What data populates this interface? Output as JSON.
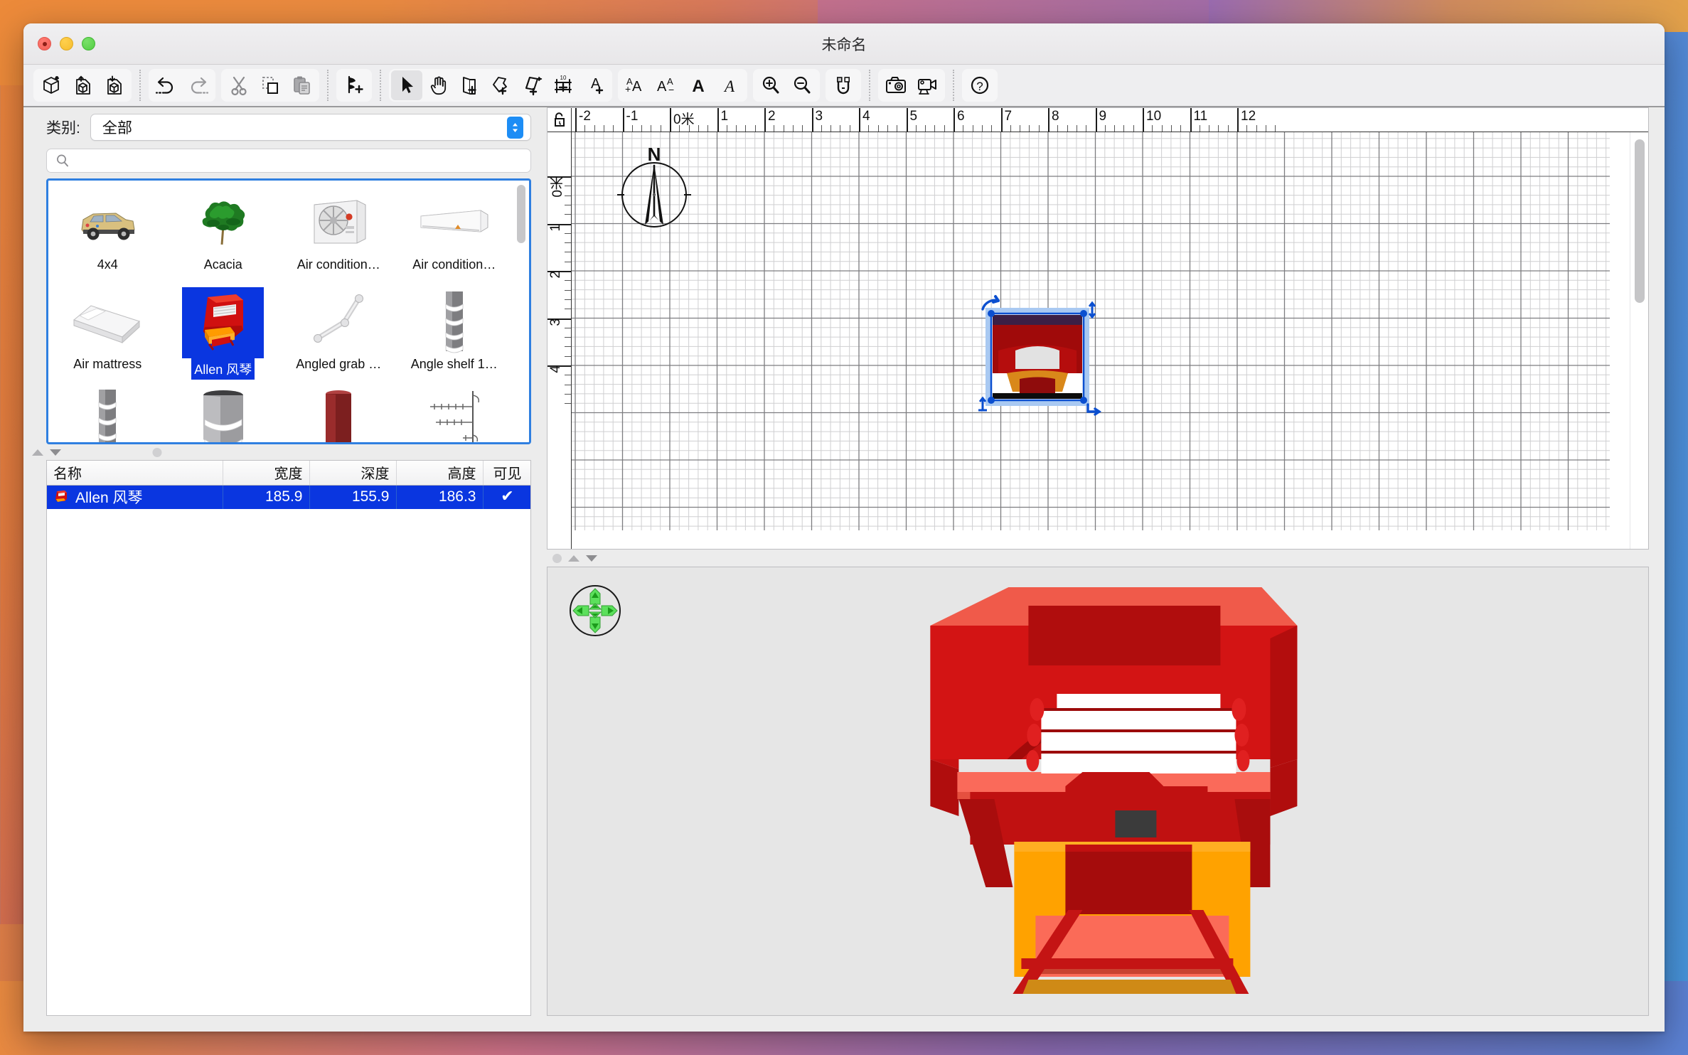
{
  "window": {
    "title": "未命名",
    "traffic_lights": [
      "close-button",
      "minimize-button",
      "zoom-button"
    ]
  },
  "toolbar": {
    "groups": [
      {
        "name": "file-group",
        "buttons": [
          {
            "name": "new-home-button",
            "icon": "new-cube-icon"
          },
          {
            "name": "open-home-button",
            "icon": "open-cube-icon"
          },
          {
            "name": "save-home-button",
            "icon": "save-cube-icon"
          }
        ]
      },
      {
        "name": "edit-history-group",
        "buttons": [
          {
            "name": "undo-button",
            "icon": "undo-arrow-icon"
          },
          {
            "name": "redo-button",
            "icon": "redo-arrow-icon"
          }
        ]
      },
      {
        "name": "clipboard-group",
        "buttons": [
          {
            "name": "cut-button",
            "icon": "scissors-icon"
          },
          {
            "name": "copy-button",
            "icon": "copy-icon"
          },
          {
            "name": "paste-button",
            "icon": "clipboard-icon"
          }
        ]
      },
      {
        "name": "furniture-group",
        "buttons": [
          {
            "name": "add-furniture-button",
            "icon": "add-furniture-icon"
          }
        ]
      },
      {
        "name": "plan-tools-group",
        "buttons": [
          {
            "name": "select-tool-button",
            "icon": "arrow-cursor-icon",
            "selected": true
          },
          {
            "name": "pan-tool-button",
            "icon": "hand-icon"
          },
          {
            "name": "create-walls-button",
            "icon": "wall-plus-icon"
          },
          {
            "name": "create-rooms-button",
            "icon": "room-plus-icon"
          },
          {
            "name": "create-polyline-button",
            "icon": "polyline-plus-icon"
          },
          {
            "name": "create-dimensions-button",
            "icon": "dimension-plus-icon"
          },
          {
            "name": "add-text-button",
            "icon": "text-plus-icon"
          }
        ]
      },
      {
        "name": "text-style-group",
        "buttons": [
          {
            "name": "increase-text-size-button",
            "icon": "text-increase-icon"
          },
          {
            "name": "decrease-text-size-button",
            "icon": "text-decrease-icon"
          },
          {
            "name": "bold-button",
            "icon": "bold-icon"
          },
          {
            "name": "italic-button",
            "icon": "italic-icon"
          }
        ]
      },
      {
        "name": "zoom-group",
        "buttons": [
          {
            "name": "zoom-in-button",
            "icon": "zoom-in-icon"
          },
          {
            "name": "zoom-out-button",
            "icon": "zoom-out-icon"
          }
        ]
      },
      {
        "name": "magnetism-group",
        "buttons": [
          {
            "name": "magnetism-toggle-button",
            "icon": "magnet-icon"
          }
        ]
      },
      {
        "name": "capture-group",
        "buttons": [
          {
            "name": "create-photo-button",
            "icon": "camera-icon"
          },
          {
            "name": "create-video-button",
            "icon": "video-camera-icon"
          }
        ]
      },
      {
        "name": "help-group",
        "buttons": [
          {
            "name": "help-button",
            "icon": "question-circle-icon"
          }
        ]
      }
    ]
  },
  "catalog": {
    "category_label": "类别:",
    "category_value": "全部",
    "search_placeholder": "",
    "search_value": "",
    "selected_item": "Allen 风琴",
    "items": [
      {
        "label": "4x4",
        "icon": "suv-vehicle-icon",
        "selected": false
      },
      {
        "label": "Acacia",
        "icon": "acacia-tree-icon",
        "selected": false
      },
      {
        "label": "Air condition…",
        "icon": "air-conditioner-outdoor-icon",
        "selected": false
      },
      {
        "label": "Air condition…",
        "icon": "air-conditioner-split-icon",
        "selected": false
      },
      {
        "label": "Air mattress",
        "icon": "air-mattress-icon",
        "selected": false
      },
      {
        "label": "Allen 风琴",
        "icon": "organ-icon",
        "selected": true
      },
      {
        "label": "Angled grab …",
        "icon": "angled-grab-bar-icon",
        "selected": false
      },
      {
        "label": "Angle shelf 1…",
        "icon": "angle-shelf-icon",
        "selected": false
      },
      {
        "label": "",
        "icon": "angle-shelf-2-icon",
        "selected": false
      },
      {
        "label": "",
        "icon": "round-shelf-icon",
        "selected": false
      },
      {
        "label": "",
        "icon": "red-cylinder-icon",
        "selected": false
      },
      {
        "label": "",
        "icon": "antenna-icon",
        "selected": false
      }
    ]
  },
  "furniture_list": {
    "columns": [
      {
        "key": "name",
        "label": "名称",
        "align": "left"
      },
      {
        "key": "width",
        "label": "宽度",
        "align": "right"
      },
      {
        "key": "depth",
        "label": "深度",
        "align": "right"
      },
      {
        "key": "height",
        "label": "高度",
        "align": "right"
      },
      {
        "key": "visible",
        "label": "可见",
        "align": "center"
      }
    ],
    "rows": [
      {
        "name": "Allen 风琴",
        "width": "185.9",
        "depth": "155.9",
        "height": "186.3",
        "visible": "✔",
        "selected": true,
        "icon": "organ-icon"
      }
    ]
  },
  "plan_view": {
    "lock_icon": "unlocked-padlock-icon",
    "unit_suffix": "米",
    "h_ruler_labels": [
      "-2",
      "-1",
      "0米",
      "1",
      "2",
      "3",
      "4",
      "5",
      "6",
      "7",
      "8",
      "9",
      "10",
      "11",
      "12"
    ],
    "v_ruler_labels": [
      "0米",
      "1",
      "2",
      "3",
      "4"
    ],
    "compass": {
      "name": "compass-rose",
      "north_label": "N"
    },
    "selected_object": {
      "name": "Allen 风琴",
      "handles": [
        "rotate-handle",
        "elevation-handle",
        "height-handle",
        "resize-handle"
      ]
    },
    "grid": true
  },
  "view3d": {
    "navigation": {
      "name": "navigation-compass",
      "buttons": [
        "pan-up",
        "pan-down",
        "pan-left",
        "pan-right",
        "zoom-in-out"
      ]
    },
    "model": "Allen 风琴",
    "background_color": "#e6e6e6"
  },
  "colors": {
    "accent_blue": "#0a36e0",
    "catalog_border": "#2f7fe0",
    "stepper_blue": "#1d8df5",
    "organ_red": "#c41010",
    "organ_orange": "#ffa200"
  }
}
